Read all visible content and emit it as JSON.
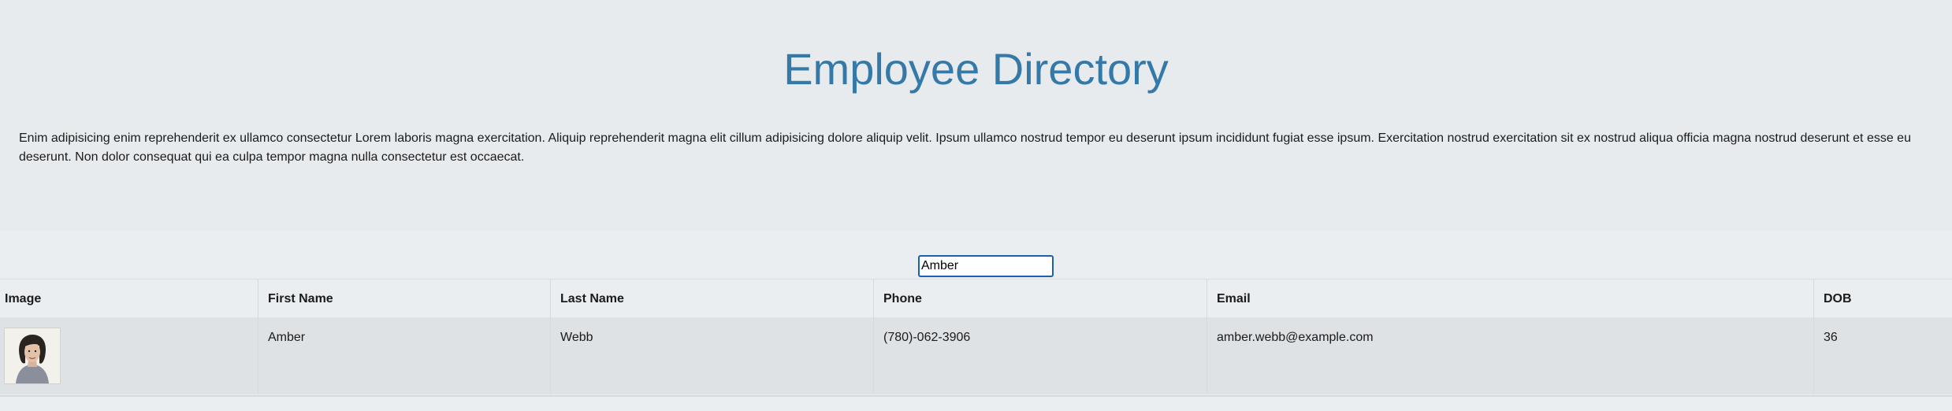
{
  "page": {
    "title": "Employee Directory",
    "intro": "Enim adipisicing enim reprehenderit ex ullamco consectetur Lorem laboris magna exercitation. Aliquip reprehenderit magna elit cillum adipisicing dolore aliquip velit. Ipsum ullamco nostrud tempor eu deserunt ipsum incididunt fugiat esse ipsum. Exercitation nostrud exercitation sit ex nostrud aliqua officia magna nostrud deserunt et esse eu deserunt. Non dolor consequat qui ea culpa tempor magna nulla consectetur est occaecat.",
    "accent_color": "#3579a9"
  },
  "search": {
    "value": "Amber"
  },
  "table": {
    "columns": [
      "Image",
      "First Name",
      "Last Name",
      "Phone",
      "Email",
      "DOB"
    ],
    "rows": [
      {
        "image_icon": "employee-photo",
        "first_name": "Amber",
        "last_name": "Webb",
        "phone": "(780)-062-3906",
        "email": "amber.webb@example.com",
        "dob": "36"
      }
    ]
  }
}
